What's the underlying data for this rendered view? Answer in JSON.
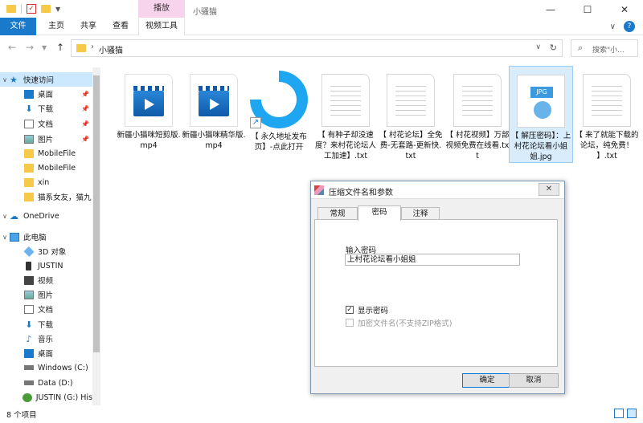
{
  "window": {
    "title": "小骚猫",
    "context_tab_head": "播放",
    "controls": {
      "minimize": "—",
      "maximize": "☐",
      "close": "✕"
    }
  },
  "ribbon": {
    "tabs": [
      "文件",
      "主页",
      "共享",
      "查看",
      "视频工具"
    ],
    "expand_glyph": "∨",
    "help_glyph": "?"
  },
  "address": {
    "path": "小骚猫",
    "search_placeholder": "搜索\"小..."
  },
  "sidebar": {
    "items": [
      {
        "label": "快速访问",
        "icon": "star-icon",
        "pinned": false,
        "level": 0
      },
      {
        "label": "桌面",
        "icon": "desktop-icon",
        "pinned": true,
        "level": 1
      },
      {
        "label": "下载",
        "icon": "download-icon",
        "pinned": true,
        "level": 1
      },
      {
        "label": "文档",
        "icon": "document-icon",
        "pinned": true,
        "level": 1
      },
      {
        "label": "图片",
        "icon": "picture-icon",
        "pinned": true,
        "level": 1
      },
      {
        "label": "MobileFile",
        "icon": "folder-icon",
        "pinned": false,
        "level": 1
      },
      {
        "label": "MobileFile",
        "icon": "folder-icon",
        "pinned": false,
        "level": 1
      },
      {
        "label": "xin",
        "icon": "folder-icon",
        "pinned": false,
        "level": 1
      },
      {
        "label": "猫系女友，猫九",
        "icon": "folder-icon",
        "pinned": false,
        "level": 1
      },
      {
        "label": "OneDrive",
        "icon": "cloud-icon",
        "pinned": false,
        "level": 0
      },
      {
        "label": "此电脑",
        "icon": "computer-icon",
        "pinned": false,
        "level": 0
      },
      {
        "label": "3D 对象",
        "icon": "cube-icon",
        "pinned": false,
        "level": 1
      },
      {
        "label": "JUSTIN",
        "icon": "phone-icon",
        "pinned": false,
        "level": 1
      },
      {
        "label": "视频",
        "icon": "video-icon",
        "pinned": false,
        "level": 1
      },
      {
        "label": "图片",
        "icon": "picture-icon",
        "pinned": false,
        "level": 1
      },
      {
        "label": "文档",
        "icon": "document-icon",
        "pinned": false,
        "level": 1
      },
      {
        "label": "下载",
        "icon": "download-icon",
        "pinned": false,
        "level": 1
      },
      {
        "label": "音乐",
        "icon": "music-icon",
        "pinned": false,
        "level": 1
      },
      {
        "label": "桌面",
        "icon": "desktop-icon",
        "pinned": false,
        "level": 1
      },
      {
        "label": "Windows (C:)",
        "icon": "drive-icon",
        "pinned": false,
        "level": 1
      },
      {
        "label": "Data (D:)",
        "icon": "drive-icon",
        "pinned": false,
        "level": 1
      },
      {
        "label": "JUSTIN (G:) His",
        "icon": "disc-icon",
        "pinned": false,
        "level": 1
      }
    ]
  },
  "files": [
    {
      "name": "新疆小猫咪短剪版.mp4",
      "kind": "video"
    },
    {
      "name": "新疆小猫咪精华版.mp4",
      "kind": "video"
    },
    {
      "name": "【 永久地址发布页】-点此打开",
      "kind": "shortcut"
    },
    {
      "name": "【 有种子却没速度？来村花论坛人工加速】.txt",
      "kind": "txt"
    },
    {
      "name": "【 村花论坛】全免费-无套路-更新快.txt",
      "kind": "txt"
    },
    {
      "name": "【 村花视频】万部视频免费在线看.txt",
      "kind": "txt"
    },
    {
      "name": "【 解压密码】：上村花论坛看小姐姐.jpg",
      "kind": "jpg"
    },
    {
      "name": "【 来了就能下载的论坛，纯免费！ 】.txt",
      "kind": "txt"
    }
  ],
  "dialog": {
    "title": "压缩文件名和参数",
    "close_glyph": "✕",
    "tabs": [
      "常规",
      "密码",
      "注释"
    ],
    "password_label": "输入密码",
    "password_value": "上村花论坛看小姐姐",
    "show_password_label": "显示密码",
    "show_password_checked": "✓",
    "encrypt_names_label": "加密文件名(不支持ZIP格式)",
    "ok_label": "确定",
    "cancel_label": "取消"
  },
  "status": {
    "item_count": "8 个项目"
  }
}
